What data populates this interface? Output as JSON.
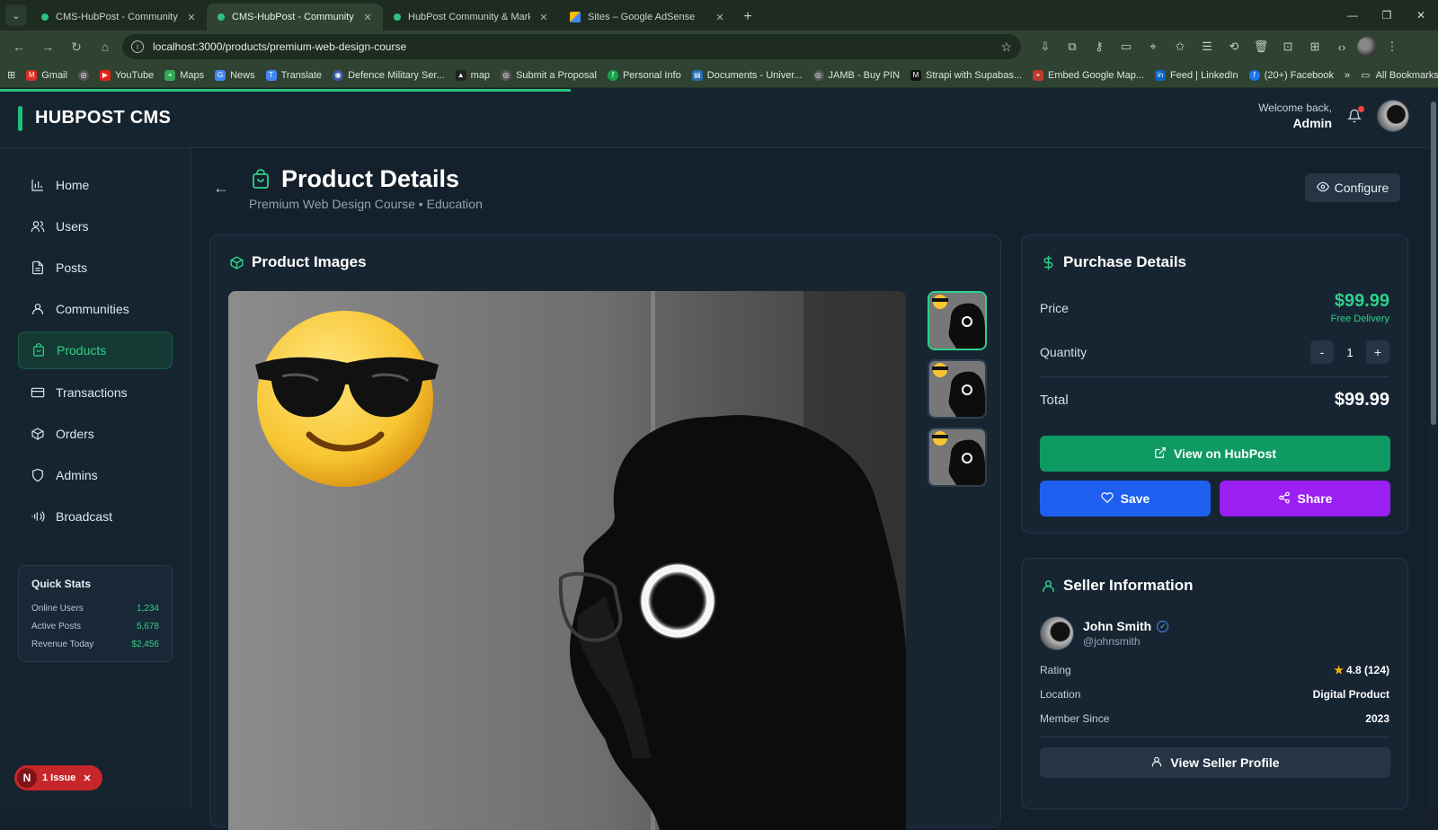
{
  "browser": {
    "tabs": [
      {
        "label": "CMS-HubPost - Community Ma",
        "active": false
      },
      {
        "label": "CMS-HubPost - Community Ma",
        "active": true
      },
      {
        "label": "HubPost Community & Market",
        "active": false
      },
      {
        "label": "Sites – Google AdSense",
        "active": false
      }
    ],
    "url": "localhost:3000/products/premium-web-design-course",
    "bookmarks": [
      "Gmail",
      "YouTube",
      "Maps",
      "News",
      "Translate",
      "Defence Military Ser...",
      "map",
      "Submit a Proposal",
      "Personal Info",
      "Documents - Univer...",
      "JAMB - Buy PIN",
      "Strapi with Supabas...",
      "Embed Google Map...",
      "Feed | LinkedIn",
      "(20+) Facebook"
    ],
    "all_bookmarks": "All Bookmarks"
  },
  "header": {
    "brand": "HUBPOST CMS",
    "welcome": "Welcome back,",
    "user": "Admin"
  },
  "sidebar": {
    "items": [
      {
        "label": "Home",
        "icon": "bar-chart-icon"
      },
      {
        "label": "Users",
        "icon": "users-icon"
      },
      {
        "label": "Posts",
        "icon": "file-icon"
      },
      {
        "label": "Communities",
        "icon": "community-icon"
      },
      {
        "label": "Products",
        "icon": "shopping-bag-icon",
        "active": true
      },
      {
        "label": "Transactions",
        "icon": "credit-card-icon"
      },
      {
        "label": "Orders",
        "icon": "package-icon"
      },
      {
        "label": "Admins",
        "icon": "shield-icon"
      },
      {
        "label": "Broadcast",
        "icon": "broadcast-icon"
      }
    ],
    "quick_stats": {
      "title": "Quick Stats",
      "rows": [
        {
          "label": "Online Users",
          "value": "1,234"
        },
        {
          "label": "Active Posts",
          "value": "5,678"
        },
        {
          "label": "Revenue Today",
          "value": "$2,456"
        }
      ]
    },
    "issue": {
      "badge": "N",
      "label": "1 Issue"
    }
  },
  "page": {
    "title": "Product Details",
    "subtitle": "Premium Web Design Course • Education",
    "configure": "Configure"
  },
  "images": {
    "title": "Product Images",
    "thumbnail_count": 3,
    "active_index": 0
  },
  "purchase": {
    "title": "Purchase Details",
    "price_label": "Price",
    "price": "$99.99",
    "delivery": "Free Delivery",
    "quantity_label": "Quantity",
    "minus": "-",
    "quantity": "1",
    "plus": "+",
    "total_label": "Total",
    "total": "$99.99",
    "view_hubpost": "View on HubPost",
    "save": "Save",
    "share": "Share"
  },
  "seller": {
    "title": "Seller Information",
    "name": "John Smith",
    "handle": "@johnsmith",
    "rating_label": "Rating",
    "rating": "4.8 (124)",
    "location_label": "Location",
    "location": "Digital Product",
    "member_label": "Member Since",
    "member_since": "2023",
    "view_profile": "View Seller Profile"
  },
  "colors": {
    "accent": "#2ed18a",
    "save": "#1f5ff0",
    "share": "#9a1ff0",
    "hubpost_button": "#0f9a63"
  }
}
